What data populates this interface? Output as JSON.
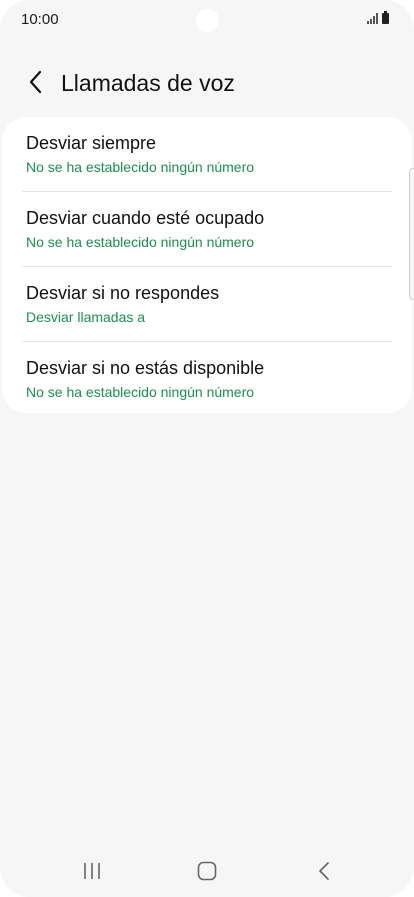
{
  "status_bar": {
    "time": "10:00"
  },
  "header": {
    "title": "Llamadas de voz",
    "back_icon": "chevron-left-icon"
  },
  "forwarding_options": [
    {
      "title": "Desviar siempre",
      "subtitle": "No se ha establecido ningún número"
    },
    {
      "title": "Desviar cuando esté ocupado",
      "subtitle": "No se ha establecido ningún número"
    },
    {
      "title": "Desviar si no respondes",
      "subtitle": "Desviar llamadas a"
    },
    {
      "title": "Desviar si no estás disponible",
      "subtitle": "No se ha establecido ningún número"
    }
  ],
  "colors": {
    "accent": "#1c8f4e",
    "background": "#f6f6f6",
    "card": "#ffffff"
  },
  "nav_bar": {
    "recents_icon": "recents-icon",
    "home_icon": "home-icon",
    "back_icon": "back-icon"
  }
}
